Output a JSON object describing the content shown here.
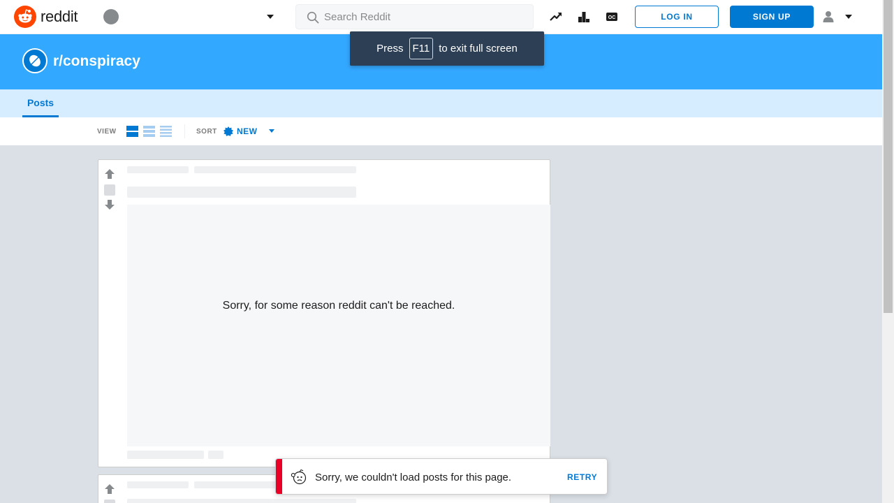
{
  "header": {
    "logo_text": "reddit",
    "search": {
      "placeholder": "Search Reddit"
    },
    "icons": [
      "trending-icon",
      "leaderboard-icon",
      "oc-icon"
    ],
    "login_label": "LOG IN",
    "signup_label": "SIGN UP"
  },
  "fullscreen_toast": {
    "before": "Press",
    "key": "F11",
    "after": "to exit full screen"
  },
  "subreddit": {
    "name": "r/conspiracy"
  },
  "tabs": [
    {
      "label": "Posts",
      "active": true
    }
  ],
  "viewbar": {
    "view_label": "VIEW",
    "sort_label": "SORT",
    "sort_value": "NEW"
  },
  "feed": {
    "error_message": "Sorry, for some reason reddit can't be reached."
  },
  "error_toast": {
    "message": "Sorry, we couldn't load posts for this page.",
    "action": "RETRY"
  },
  "colors": {
    "accent": "#0079d3",
    "banner": "#33a8ff",
    "tab_bg": "#d6ecff",
    "brand": "#ff4500",
    "error": "#ea0027"
  }
}
